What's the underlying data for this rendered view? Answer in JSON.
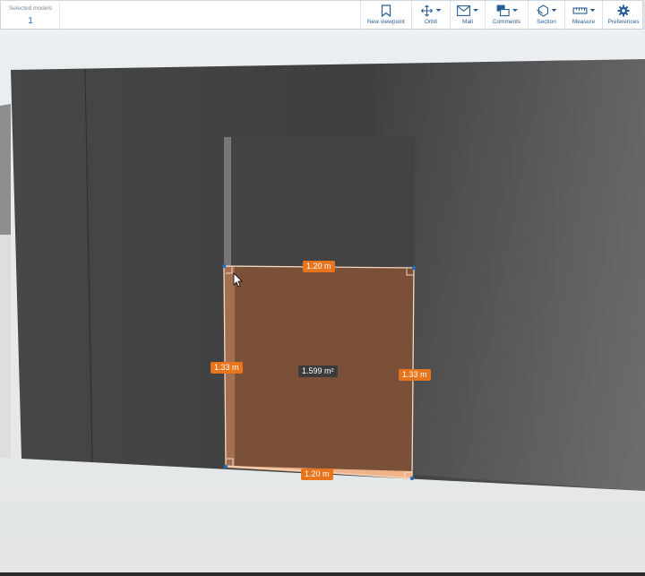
{
  "selected_models": {
    "label": "Selected models",
    "value": "1"
  },
  "toolbar": {
    "new_viewpoint": "New viewpoint",
    "orbit": "Orbit",
    "mail": "Mail",
    "comments": "Comments",
    "section": "Section",
    "measure": "Measure",
    "preferences": "Preferences"
  },
  "measurements": {
    "top_width": "1.20 m",
    "bottom_width": "1.20 m",
    "left_height": "1.33 m",
    "right_height": "1.33 m",
    "area": "1.599 m²"
  },
  "colors": {
    "accent": "#e8741c",
    "toolbar_text": "#2a5d92",
    "wall": "#4a4a4a",
    "measured_area": "#7a5138"
  }
}
